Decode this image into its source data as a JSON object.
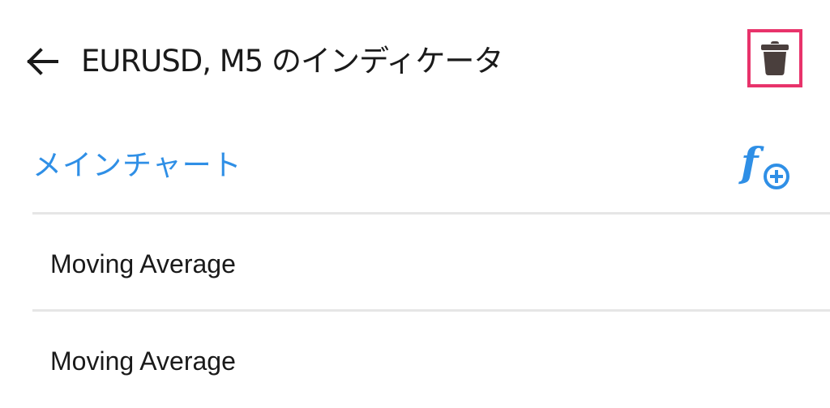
{
  "header": {
    "title": "EURUSD, M5 のインディケータ",
    "back_icon": "arrow-left-icon",
    "delete_icon": "trash-icon",
    "highlight_color": "#e8336b"
  },
  "section": {
    "title": "メインチャート",
    "accent_color": "#2f8fe6",
    "add_icon": "function-add-icon"
  },
  "indicators": [
    {
      "label": "Moving Average"
    },
    {
      "label": "Moving Average"
    }
  ]
}
